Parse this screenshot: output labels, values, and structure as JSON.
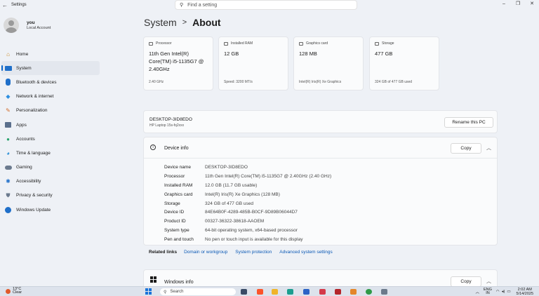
{
  "window": {
    "title": "Settings",
    "search_placeholder": "Find a setting"
  },
  "user": {
    "name": "you",
    "account": "Local Account"
  },
  "nav": [
    {
      "label": "Home",
      "icon": "home-icon",
      "color": "#c9861f"
    },
    {
      "label": "System",
      "icon": "monitor-icon",
      "color": "#1f6fc9"
    },
    {
      "label": "Bluetooth & devices",
      "icon": "bluetooth-icon",
      "color": "#1f6fc9"
    },
    {
      "label": "Network & internet",
      "icon": "wifi-icon",
      "color": "#2d8fe0"
    },
    {
      "label": "Personalization",
      "icon": "brush-icon",
      "color": "#d26b2a"
    },
    {
      "label": "Apps",
      "icon": "apps-icon",
      "color": "#5a6f8c"
    },
    {
      "label": "Accounts",
      "icon": "person-icon",
      "color": "#2aa36d"
    },
    {
      "label": "Time & language",
      "icon": "globe-clock-icon",
      "color": "#2a8fd6"
    },
    {
      "label": "Gaming",
      "icon": "gamepad-icon",
      "color": "#6b7a8e"
    },
    {
      "label": "Accessibility",
      "icon": "accessibility-icon",
      "color": "#1f6fc9"
    },
    {
      "label": "Privacy & security",
      "icon": "shield-icon",
      "color": "#6b7a8e"
    },
    {
      "label": "Windows Update",
      "icon": "update-icon",
      "color": "#1f6fc9"
    }
  ],
  "breadcrumb": {
    "parent": "System",
    "separator": ">",
    "current": "About"
  },
  "specs": [
    {
      "label": "Processor",
      "value": "11th Gen Intel(R) Core(TM) i5-1135G7 @ 2.40GHz",
      "sub": "2.40 GHz"
    },
    {
      "label": "Installed RAM",
      "value": "12 GB",
      "sub": "Speed: 3200 MT/s"
    },
    {
      "label": "Graphics card",
      "value": "128 MB",
      "sub": "Intel(R) Iris(R) Xe Graphics"
    },
    {
      "label": "Storage",
      "value": "477 GB",
      "sub": "324 GB of 477 GB used"
    }
  ],
  "device": {
    "name": "DESKTOP-3ID8EDO",
    "model": "HP Laptop 15s-fq2xxx",
    "rename_label": "Rename this PC"
  },
  "device_info": {
    "title": "Device info",
    "copy_label": "Copy",
    "rows": [
      {
        "key": "Device name",
        "value": "DESKTOP-3ID8EDO"
      },
      {
        "key": "Processor",
        "value": "11th Gen Intel(R) Core(TM) i5-1135G7 @ 2.40GHz (2.40 GHz)"
      },
      {
        "key": "Installed RAM",
        "value": "12.0 GB (11.7 GB usable)"
      },
      {
        "key": "Graphics card",
        "value": "Intel(R) Iris(R) Xe Graphics (128 MB)"
      },
      {
        "key": "Storage",
        "value": "324 GB of 477 GB used"
      },
      {
        "key": "Device ID",
        "value": "84E64B0F-4289-485B-B0CF-9D89B06044D7"
      },
      {
        "key": "Product ID",
        "value": "00327-36322-38618-AAOEM"
      },
      {
        "key": "System type",
        "value": "64-bit operating system, x64-based processor"
      },
      {
        "key": "Pen and touch",
        "value": "No pen or touch input is available for this display"
      }
    ]
  },
  "related": {
    "label": "Related links",
    "links": [
      "Domain or workgroup",
      "System protection",
      "Advanced system settings"
    ]
  },
  "windows_info": {
    "title": "Windows info",
    "copy_label": "Copy"
  },
  "taskbar": {
    "weather_temp": "13°C",
    "weather_text": "Clear",
    "search_label": "Search",
    "lang_top": "ENG",
    "lang_bottom": "IN",
    "time": "2:02 AM",
    "date": "5/14/2025"
  }
}
